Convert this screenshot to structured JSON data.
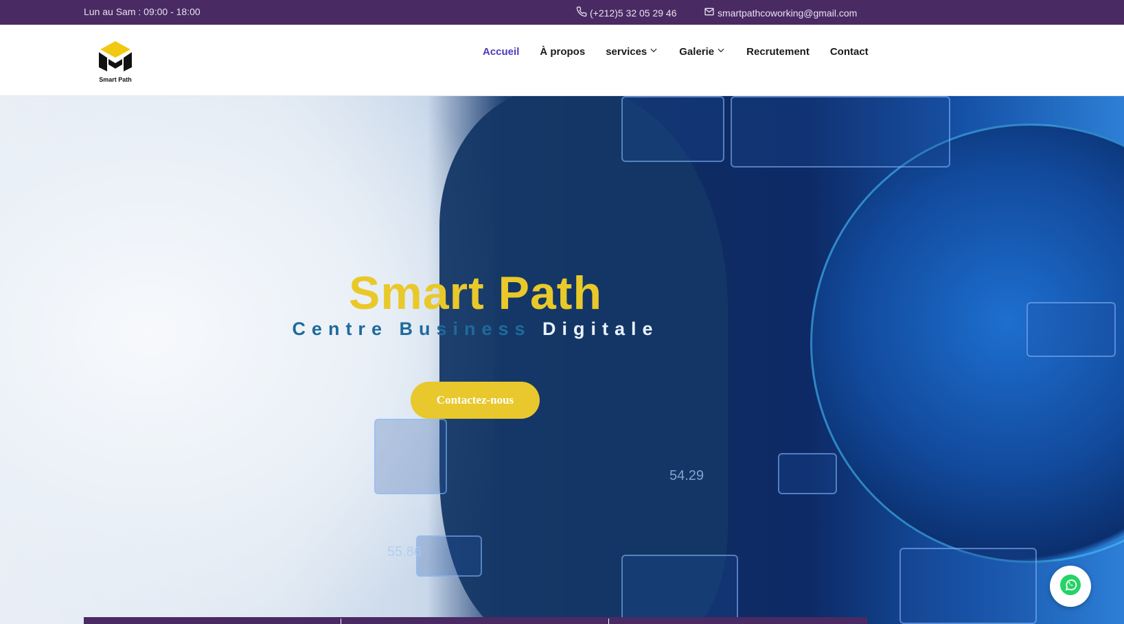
{
  "topbar": {
    "hours": "Lun au Sam : 09:00 - 18:00",
    "phone": "(+212)5 32 05 29 46",
    "email": "smartpathcoworking@gmail.com",
    "phone_icon": "phone-icon",
    "email_icon": "mail-icon",
    "bg_color": "#4a2a63"
  },
  "header": {
    "logo_text": "Smart Path",
    "nav": [
      {
        "label": "Accueil",
        "active": true
      },
      {
        "label": "À propos"
      },
      {
        "label": "services",
        "dropdown": true
      },
      {
        "label": "Galerie",
        "dropdown": true
      },
      {
        "label": "Recrutement"
      },
      {
        "label": "Contact"
      }
    ],
    "active_color": "#4a3bb8"
  },
  "hero": {
    "title": "Smart Path",
    "subtitle_part1": "Centre Business",
    "subtitle_part2": "Digitale",
    "cta_label": "Contactez-nous",
    "readout_1": "55.86",
    "readout_2": "54.29",
    "accent_color": "#e8c82c"
  },
  "whatsapp": {
    "icon": "whatsapp-icon"
  }
}
